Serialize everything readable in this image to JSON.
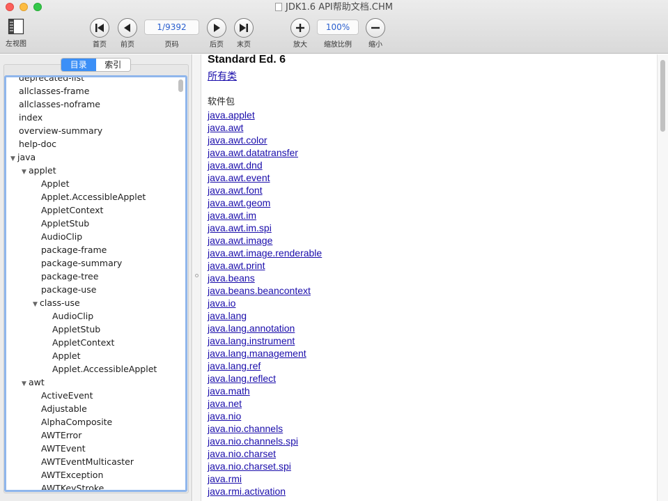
{
  "window": {
    "title": "JDK1.6 API帮助文档.CHM"
  },
  "toolbar": {
    "left_view_label": "左视图",
    "first_label": "首页",
    "prev_label": "前页",
    "page_field": "1/9392",
    "page_label": "页码",
    "next_label": "后页",
    "last_label": "末页",
    "zoom_in_label": "放大",
    "zoom_field": "100%",
    "zoom_label": "缩放比例",
    "zoom_out_label": "缩小"
  },
  "sidebar": {
    "tabs": {
      "contents": "目录",
      "index": "索引"
    },
    "tree": [
      {
        "label": "deprecated-list",
        "level": 0,
        "expanded": null
      },
      {
        "label": "allclasses-frame",
        "level": 0,
        "expanded": null
      },
      {
        "label": "allclasses-noframe",
        "level": 0,
        "expanded": null
      },
      {
        "label": "index",
        "level": 0,
        "expanded": null
      },
      {
        "label": "overview-summary",
        "level": 0,
        "expanded": null
      },
      {
        "label": "help-doc",
        "level": 0,
        "expanded": null
      },
      {
        "label": "java",
        "level": 0,
        "expanded": true
      },
      {
        "label": "applet",
        "level": 1,
        "expanded": true
      },
      {
        "label": "Applet",
        "level": 2,
        "expanded": null
      },
      {
        "label": "Applet.AccessibleApplet",
        "level": 2,
        "expanded": null
      },
      {
        "label": "AppletContext",
        "level": 2,
        "expanded": null
      },
      {
        "label": "AppletStub",
        "level": 2,
        "expanded": null
      },
      {
        "label": "AudioClip",
        "level": 2,
        "expanded": null
      },
      {
        "label": "package-frame",
        "level": 2,
        "expanded": null
      },
      {
        "label": "package-summary",
        "level": 2,
        "expanded": null
      },
      {
        "label": "package-tree",
        "level": 2,
        "expanded": null
      },
      {
        "label": "package-use",
        "level": 2,
        "expanded": null
      },
      {
        "label": "class-use",
        "level": 2,
        "expanded": true
      },
      {
        "label": "AudioClip",
        "level": 3,
        "expanded": null
      },
      {
        "label": "AppletStub",
        "level": 3,
        "expanded": null
      },
      {
        "label": "AppletContext",
        "level": 3,
        "expanded": null
      },
      {
        "label": "Applet",
        "level": 3,
        "expanded": null
      },
      {
        "label": "Applet.AccessibleApplet",
        "level": 3,
        "expanded": null
      },
      {
        "label": "awt",
        "level": 1,
        "expanded": true
      },
      {
        "label": "ActiveEvent",
        "level": 2,
        "expanded": null
      },
      {
        "label": "Adjustable",
        "level": 2,
        "expanded": null
      },
      {
        "label": "AlphaComposite",
        "level": 2,
        "expanded": null
      },
      {
        "label": "AWTError",
        "level": 2,
        "expanded": null
      },
      {
        "label": "AWTEvent",
        "level": 2,
        "expanded": null
      },
      {
        "label": "AWTEventMulticaster",
        "level": 2,
        "expanded": null
      },
      {
        "label": "AWTException",
        "level": 2,
        "expanded": null
      },
      {
        "label": "AWTKeyStroke",
        "level": 2,
        "expanded": null
      }
    ]
  },
  "content": {
    "heading": "Standard Ed. 6",
    "all_classes": "所有类",
    "section_title": "软件包",
    "packages": [
      "java.applet",
      "java.awt",
      "java.awt.color",
      "java.awt.datatransfer",
      "java.awt.dnd",
      "java.awt.event",
      "java.awt.font",
      "java.awt.geom",
      "java.awt.im",
      "java.awt.im.spi",
      "java.awt.image",
      "java.awt.image.renderable",
      "java.awt.print",
      "java.beans",
      "java.beans.beancontext",
      "java.io",
      "java.lang",
      "java.lang.annotation",
      "java.lang.instrument",
      "java.lang.management",
      "java.lang.ref",
      "java.lang.reflect",
      "java.math",
      "java.net",
      "java.nio",
      "java.nio.channels",
      "java.nio.channels.spi",
      "java.nio.charset",
      "java.nio.charset.spi",
      "java.rmi",
      "java.rmi.activation"
    ]
  },
  "colors": {
    "accent": "#3b8ff7",
    "link": "#1a0dab",
    "focus_ring": "#8fb6ec"
  }
}
